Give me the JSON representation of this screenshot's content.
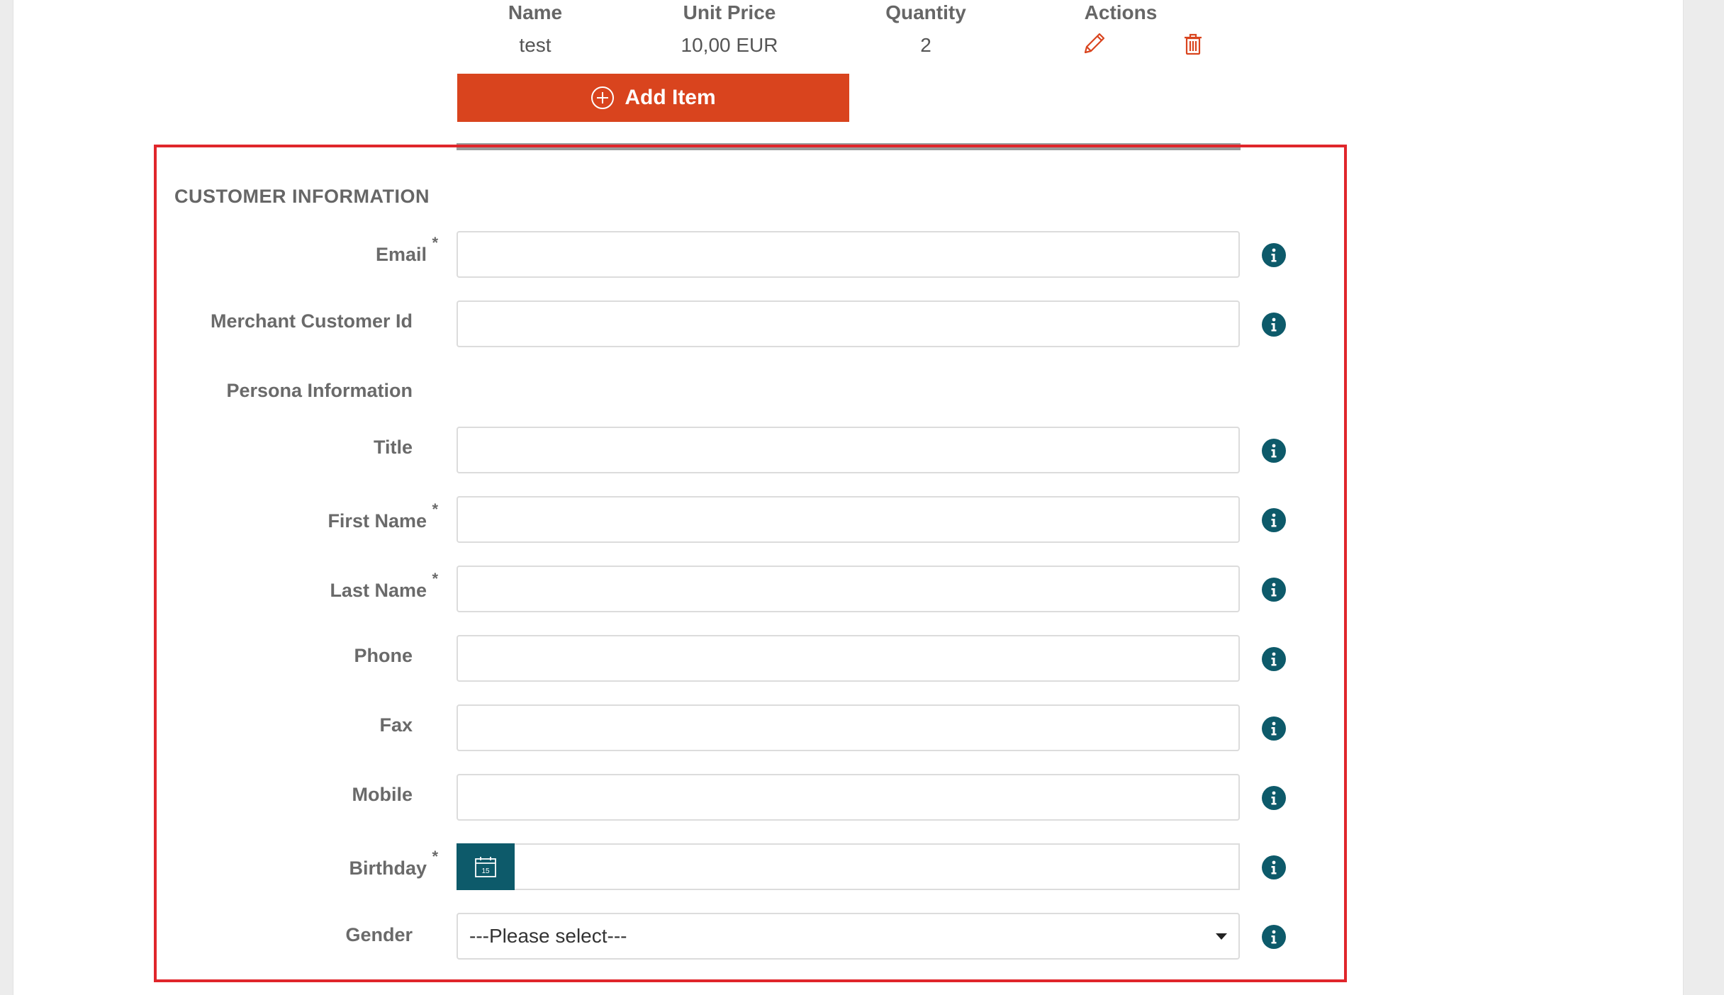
{
  "items_table": {
    "headers": {
      "name": "Name",
      "unit_price": "Unit Price",
      "quantity": "Quantity",
      "actions": "Actions"
    },
    "rows": [
      {
        "name": "test",
        "unit_price": "10,00 EUR",
        "quantity": "2"
      }
    ],
    "add_item_label": "Add Item"
  },
  "customer_info": {
    "section_title": "CUSTOMER INFORMATION",
    "email_label": "Email",
    "merchant_customer_id_label": "Merchant Customer Id",
    "persona_heading": "Persona Information",
    "title_label": "Title",
    "first_name_label": "First Name",
    "last_name_label": "Last Name",
    "phone_label": "Phone",
    "fax_label": "Fax",
    "mobile_label": "Mobile",
    "birthday_label": "Birthday",
    "gender_label": "Gender",
    "gender_value": "---Please select---",
    "required_marker": "*",
    "calendar_day": "15"
  },
  "colors": {
    "accent": "#d9441e",
    "info": "#0d5a6a",
    "highlight": "#e0262b"
  },
  "icons": [
    "pencil-icon",
    "trash-icon",
    "plus-circle-icon",
    "info-icon",
    "calendar-icon",
    "caret-down-icon"
  ]
}
